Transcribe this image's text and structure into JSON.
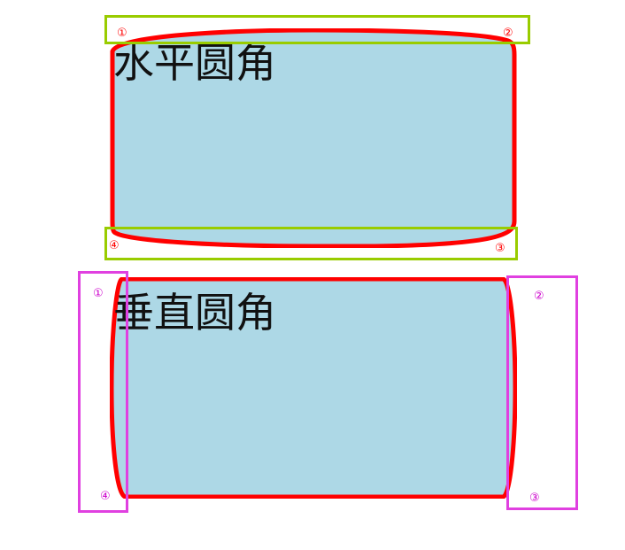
{
  "colors": {
    "fill": "#add8e6",
    "stroke": "#ff0000",
    "green_frame": "#99cc00",
    "magenta_frame": "#e040e0",
    "marker_red": "#ff0000",
    "marker_magenta": "#cc00cc"
  },
  "boxes": {
    "horizontal": {
      "label": "水平圆角"
    },
    "vertical": {
      "label": "垂直圆角"
    }
  },
  "markers": {
    "top_left": "①",
    "top_right": "②",
    "bottom_right": "③",
    "bottom_left": "④"
  }
}
